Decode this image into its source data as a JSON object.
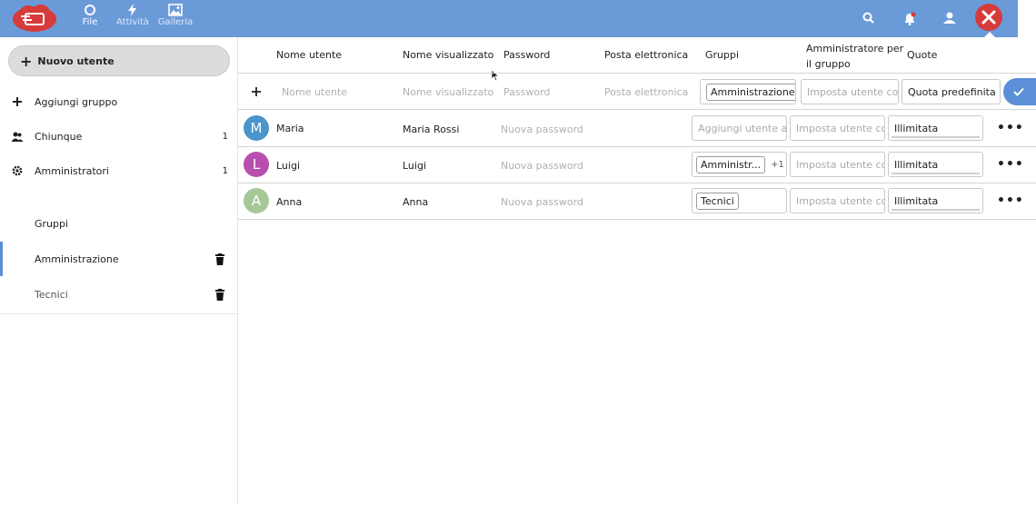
{
  "colors": {
    "header": "#6b9ad9",
    "accent": "#5b8fd8",
    "danger": "#d63b3b"
  },
  "header": {
    "apps": [
      {
        "label": "File",
        "icon": "folder-icon",
        "active": true
      },
      {
        "label": "Attività",
        "icon": "lightning-icon",
        "active": false
      },
      {
        "label": "Galleria",
        "icon": "image-icon",
        "active": false
      }
    ],
    "icons": [
      "search-icon",
      "notifications-icon",
      "contacts-icon",
      "user-avatar-icon"
    ]
  },
  "sidebar": {
    "new_user": "Nuovo utente",
    "add_group": "Aggiungi gruppo",
    "everyone": {
      "label": "Chiunque",
      "count": "1"
    },
    "admins": {
      "label": "Amministratori",
      "count": "1"
    },
    "groups_header": "Gruppi",
    "groups": [
      {
        "label": "Amministrazione"
      },
      {
        "label": "Tecnici"
      }
    ]
  },
  "table": {
    "headers": {
      "username": "Nome utente",
      "display_name": "Nome visualizzato",
      "password": "Password",
      "email": "Posta elettronica",
      "groups": "Gruppi",
      "group_admin_line1": "Amministratore per",
      "group_admin_line2": "il gruppo",
      "quota": "Quote"
    },
    "new_row": {
      "username_placeholder": "Nome utente",
      "display_name_placeholder": "Nome visualizzato",
      "password_placeholder": "Password",
      "email_placeholder": "Posta elettronica",
      "group_tag": "Amministrazione",
      "group_admin_placeholder": "Imposta utente con",
      "quota_value": "Quota predefinita"
    },
    "users": [
      {
        "initial": "M",
        "color": "#4a95c9",
        "username": "Maria",
        "display_name": "Maria Rossi",
        "password_placeholder": "Nuova password",
        "groups_placeholder": "Aggiungi utente a",
        "group_admin_placeholder": "Imposta utente co",
        "quota": "Illimitata"
      },
      {
        "initial": "L",
        "color": "#b84fae",
        "username": "Luigi",
        "display_name": "Luigi",
        "password_placeholder": "Nuova password",
        "group_tag": "Amministr...",
        "group_more": "+1",
        "group_admin_placeholder": "Imposta utente co",
        "quota": "Illimitata"
      },
      {
        "initial": "A",
        "color": "#a6c796",
        "username": "Anna",
        "display_name": "Anna",
        "password_placeholder": "Nuova password",
        "group_tag": "Tecnici",
        "group_admin_placeholder": "Imposta utente co",
        "quota": "Illimitata"
      }
    ],
    "more_label": "•••"
  }
}
